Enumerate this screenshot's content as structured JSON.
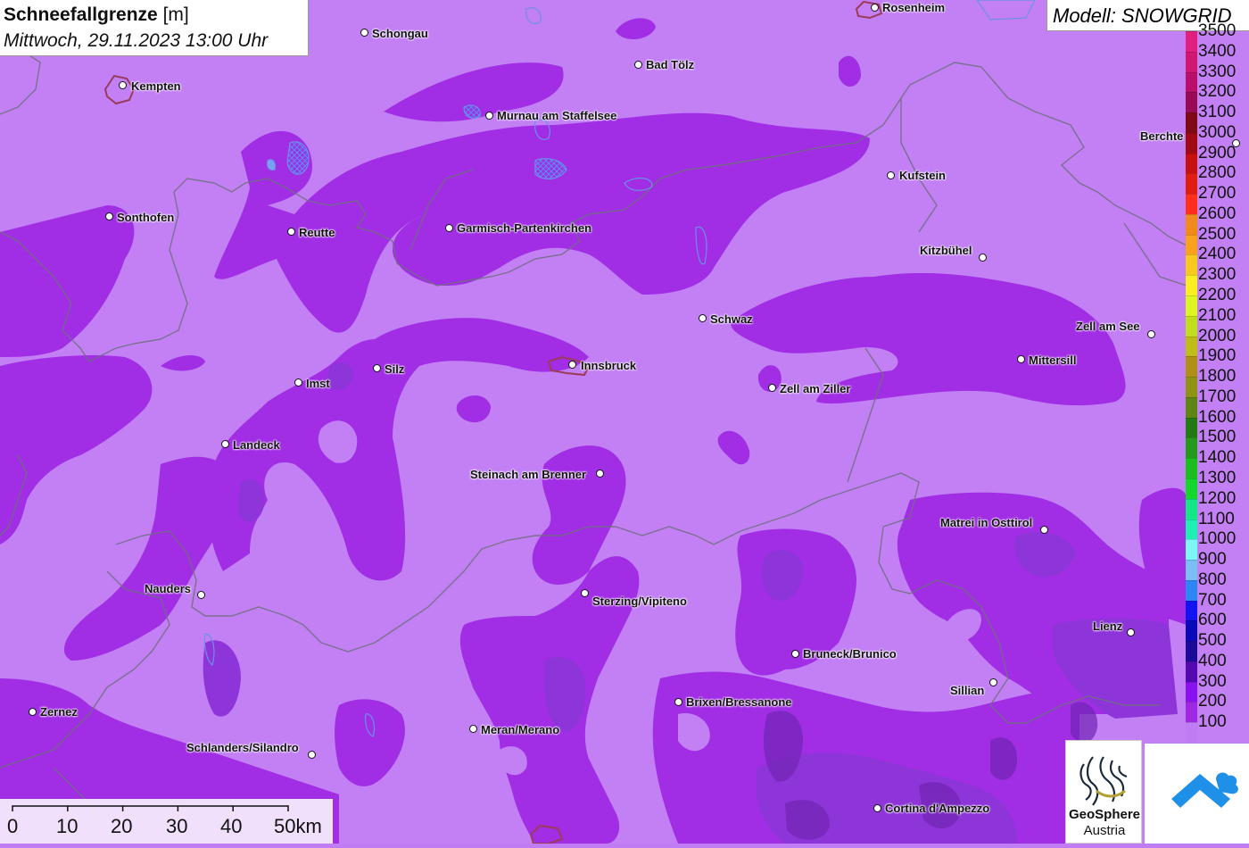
{
  "title": {
    "main": "Schneefallgrenze",
    "unit": "[m]",
    "datetime": "Mittwoch, 29.11.2023 13:00 Uhr"
  },
  "model": "Modell: SNOWGRID",
  "legend": [
    {
      "label": "3500",
      "color": "#e0207e"
    },
    {
      "label": "3400",
      "color": "#d01873"
    },
    {
      "label": "3300",
      "color": "#b8106a"
    },
    {
      "label": "3200",
      "color": "#980a55"
    },
    {
      "label": "3100",
      "color": "#800a18"
    },
    {
      "label": "3000",
      "color": "#a00a12"
    },
    {
      "label": "2900",
      "color": "#c8100e"
    },
    {
      "label": "2800",
      "color": "#e01e10"
    },
    {
      "label": "2700",
      "color": "#ff2f1a"
    },
    {
      "label": "2600",
      "color": "#f08a1a"
    },
    {
      "label": "2500",
      "color": "#f8a21c"
    },
    {
      "label": "2400",
      "color": "#f8c81e"
    },
    {
      "label": "2300",
      "color": "#f8ee22"
    },
    {
      "label": "2200",
      "color": "#ddf520"
    },
    {
      "label": "2100",
      "color": "#c2dc1e"
    },
    {
      "label": "2000",
      "color": "#c0bc16"
    },
    {
      "label": "1900",
      "color": "#b09014"
    },
    {
      "label": "1800",
      "color": "#8e9412"
    },
    {
      "label": "1700",
      "color": "#5e8412"
    },
    {
      "label": "1600",
      "color": "#247a12"
    },
    {
      "label": "1500",
      "color": "#249a1a"
    },
    {
      "label": "1400",
      "color": "#1cbe1c"
    },
    {
      "label": "1300",
      "color": "#12d82c"
    },
    {
      "label": "1200",
      "color": "#12e886"
    },
    {
      "label": "1100",
      "color": "#1ef0b4"
    },
    {
      "label": "1000",
      "color": "#7af8f4"
    },
    {
      "label": "900",
      "color": "#7abef4"
    },
    {
      "label": "800",
      "color": "#2c86f4"
    },
    {
      "label": "700",
      "color": "#1414f0"
    },
    {
      "label": "600",
      "color": "#0a0ab8"
    },
    {
      "label": "500",
      "color": "#1c0a98"
    },
    {
      "label": "400",
      "color": "#520ab0"
    },
    {
      "label": "300",
      "color": "#8a12f0"
    },
    {
      "label": "200",
      "color": "#9e28e4"
    },
    {
      "label": "100",
      "color": "#c07cf4"
    }
  ],
  "scale": {
    "labels": [
      "0",
      "10",
      "20",
      "30",
      "40",
      "50km"
    ]
  },
  "cities": [
    {
      "name": "Rosenheim"
    },
    {
      "name": "Schongau"
    },
    {
      "name": "Bad Tölz"
    },
    {
      "name": "Kempten"
    },
    {
      "name": "Murnau am Staffelsee"
    },
    {
      "name": "Berchte"
    },
    {
      "name": "Kufstein"
    },
    {
      "name": "Sonthofen"
    },
    {
      "name": "Reutte"
    },
    {
      "name": "Garmisch-Partenkirchen"
    },
    {
      "name": "Kitzbühel"
    },
    {
      "name": "Schwaz"
    },
    {
      "name": "Zell am See"
    },
    {
      "name": "Mittersill"
    },
    {
      "name": "Silz"
    },
    {
      "name": "Innsbruck"
    },
    {
      "name": "Imst"
    },
    {
      "name": "Zell am Ziller"
    },
    {
      "name": "Landeck"
    },
    {
      "name": "Steinach am Brenner"
    },
    {
      "name": "Matrei in Osttirol"
    },
    {
      "name": "Nauders"
    },
    {
      "name": "Sterzing/Vipiteno"
    },
    {
      "name": "Lienz"
    },
    {
      "name": "Bruneck/Brunico"
    },
    {
      "name": "Sillian"
    },
    {
      "name": "Brixen/Bressanone"
    },
    {
      "name": "Zernez"
    },
    {
      "name": "Meran/Merano"
    },
    {
      "name": "Schlanders/Silandro"
    },
    {
      "name": "Cortina d'Ampezzo"
    }
  ],
  "logos": {
    "geosphere_line1": "GeoSphere",
    "geosphere_line2": "Austria"
  }
}
